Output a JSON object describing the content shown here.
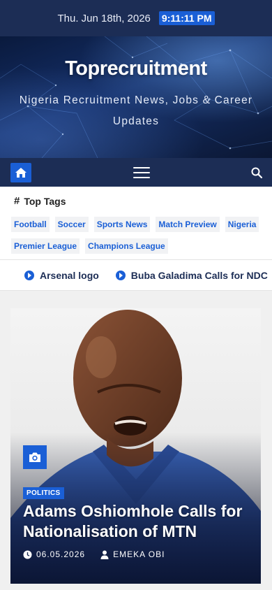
{
  "topbar": {
    "date": "Thu. Jun 18th, 2026",
    "time": "9:11:11 PM"
  },
  "header": {
    "site_title": "Toprecruitment",
    "tagline": "Nigeria Recruitment News, Jobs & Career Updates"
  },
  "navbar": {
    "home_icon": "home-icon",
    "menu_icon": "hamburger-icon",
    "search_icon": "search-icon"
  },
  "top_tags": {
    "title": "Top Tags",
    "tags": [
      "Football",
      "Soccer",
      "Sports News",
      "Match Preview",
      "Nigeria",
      "Premier League",
      "Champions League"
    ]
  },
  "ticker": {
    "items": [
      "Arsenal logo",
      "Buba Galadima Calls for NDC"
    ]
  },
  "featured": {
    "category": "POLITICS",
    "headline": "Adams Oshiomhole Calls for Nationalisation of MTN",
    "date": "06.05.2026",
    "author": "EMEKA OBI"
  },
  "colors": {
    "navy": "#1c2d55",
    "accent": "#1a5fd6"
  }
}
